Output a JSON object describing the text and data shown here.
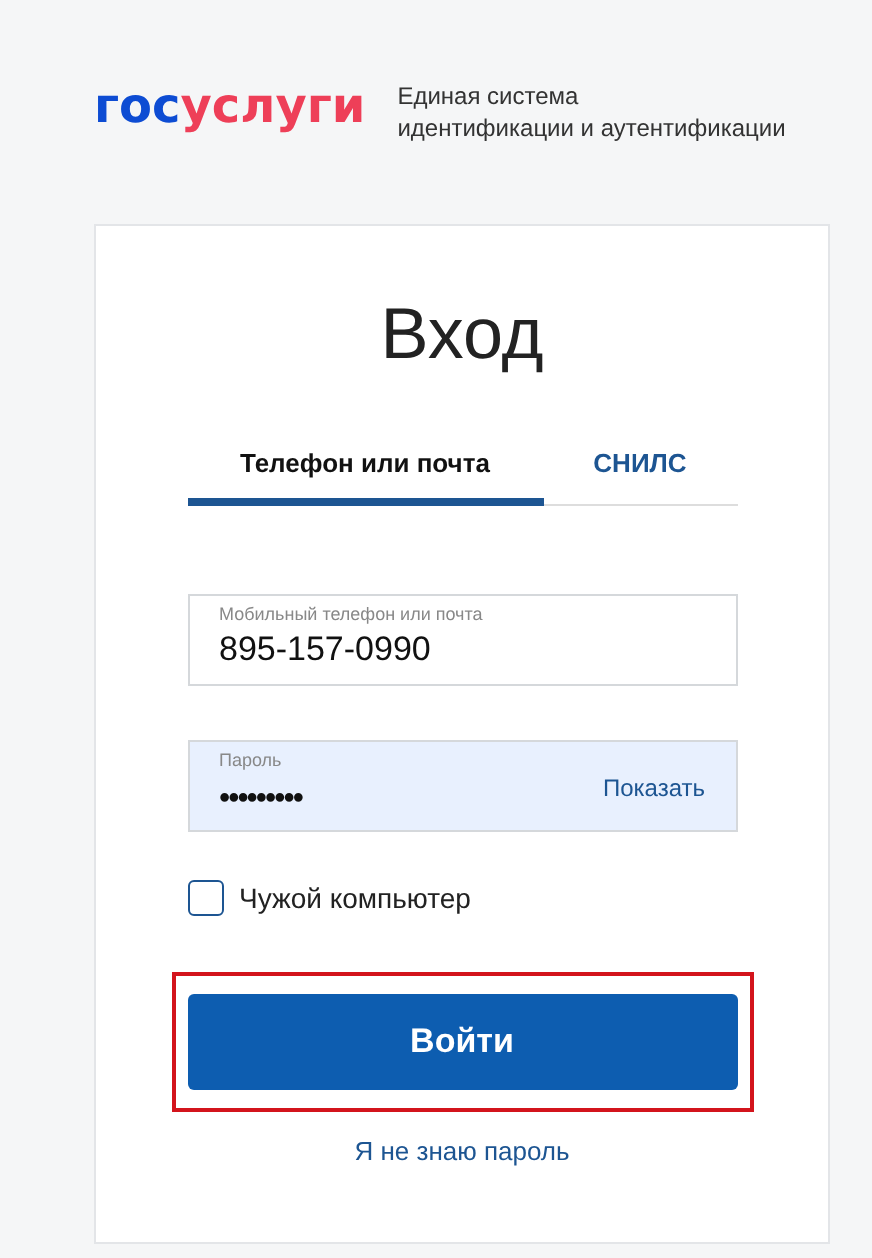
{
  "header": {
    "logo": [
      {
        "text": "гос",
        "color": "#0d4cd3"
      },
      {
        "text": "услуги",
        "color": "#ee3f58"
      }
    ],
    "tagline": [
      "Единая система",
      "идентификации и аутентификации"
    ]
  },
  "title": "Вход",
  "tabs": [
    {
      "label": "Телефон или почта",
      "selected": true
    },
    {
      "label": "СНИЛС",
      "selected": false
    }
  ],
  "fields": [
    {
      "kind": "text",
      "label": "Мобильный телефон или почта",
      "value": "895-157-0990"
    },
    {
      "kind": "password",
      "label": "Пароль",
      "value": "•••••••••",
      "action": "Показать"
    }
  ],
  "checkbox": {
    "label": "Чужой компьютер",
    "checked": false
  },
  "login_button": {
    "label": "Войти",
    "highlighted": true
  },
  "forgot_link": "Я не знаю пароль"
}
